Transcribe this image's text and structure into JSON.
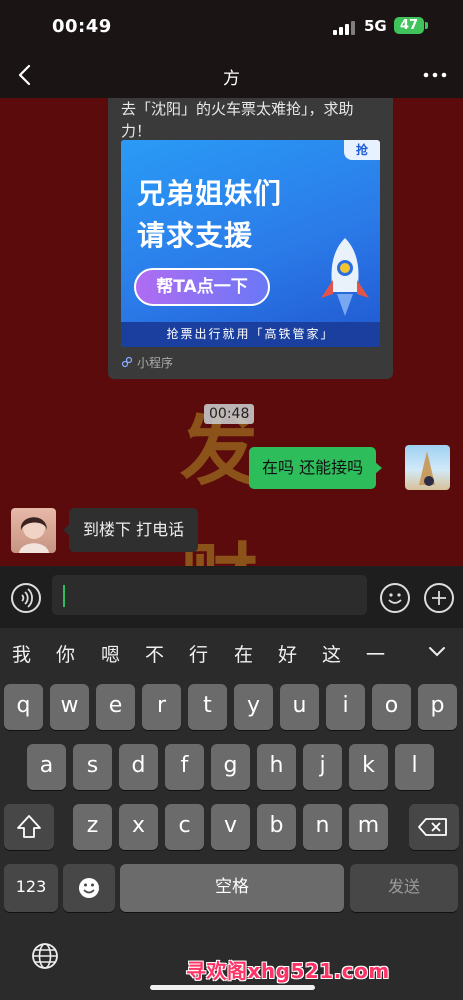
{
  "status_bar": {
    "time": "00:49",
    "network": "5G",
    "battery": "47"
  },
  "nav": {
    "title": "方"
  },
  "chat": {
    "card": {
      "text": "去「沈阳」的火车票太难抢」，求助力！",
      "headline_1": "兄弟姐妹们",
      "headline_2": "请求支援",
      "help_button": "帮TA点一下",
      "tag": "抢",
      "footer": "抢票出行就用「高铁管家」",
      "mini_program": "小程序"
    },
    "timestamp": "00:48",
    "messages": [
      {
        "from": "me",
        "text": "在吗 还能接吗"
      },
      {
        "from": "other",
        "text": "到楼下 打电话"
      }
    ],
    "background_chars": [
      "发",
      "财"
    ]
  },
  "input": {
    "value": ""
  },
  "keyboard": {
    "candidates": [
      "我",
      "你",
      "嗯",
      "不",
      "行",
      "在",
      "好",
      "这",
      "一"
    ],
    "row1": [
      "q",
      "w",
      "e",
      "r",
      "t",
      "y",
      "u",
      "i",
      "o",
      "p"
    ],
    "row2": [
      "a",
      "s",
      "d",
      "f",
      "g",
      "h",
      "j",
      "k",
      "l"
    ],
    "row3": [
      "z",
      "x",
      "c",
      "v",
      "b",
      "n",
      "m"
    ],
    "num_key": "123",
    "space": "空格",
    "send": "发送"
  },
  "watermark": "寻欢阁xhg521.com",
  "colors": {
    "chat_bg": "#5b0b0b",
    "my_bubble": "#2dbd5b",
    "accent": "#2b7be9"
  }
}
